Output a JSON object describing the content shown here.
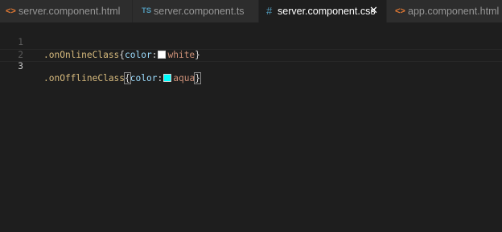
{
  "tabs": [
    {
      "icon": "<>",
      "label": "server.component.html",
      "active": false
    },
    {
      "icon": "TS",
      "label": "server.component.ts",
      "active": false
    },
    {
      "icon": "#",
      "label": "server.component.css",
      "active": true,
      "close": "✕"
    },
    {
      "icon": "<>",
      "label": "app.component.html",
      "active": false
    }
  ],
  "editor": {
    "lines": [
      {
        "number": "1",
        "selector": ".onOnlineClass",
        "open": "{",
        "property": "color",
        "colon": ":",
        "swatch_color": "#ffffff",
        "value": "white",
        "close": "}"
      },
      {
        "number": "2"
      },
      {
        "number": "3",
        "selector": ".onOfflineClass",
        "open": "{",
        "property": "color",
        "colon": ":",
        "swatch_color": "#00ffff",
        "value": "aqua",
        "close": "}"
      }
    ]
  },
  "colors": {
    "editor_background": "#1e1e1e",
    "tabbar_background": "#252526",
    "inactive_tab": "#2d2d2d",
    "selector": "#d7ba7d",
    "property": "#9cdcfe",
    "value": "#ce9178"
  }
}
